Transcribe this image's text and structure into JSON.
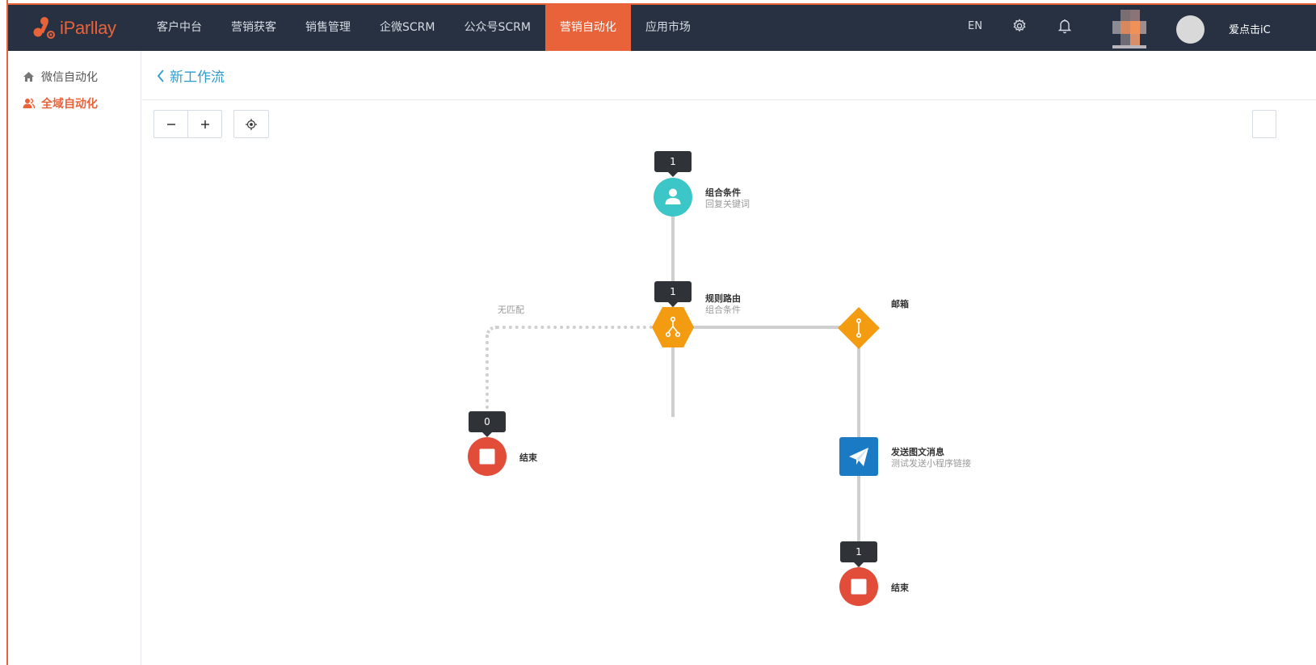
{
  "app": {
    "logo_text": "iParllay"
  },
  "nav": {
    "items": [
      "客户中台",
      "营销获客",
      "销售管理",
      "企微SCRM",
      "公众号SCRM",
      "营销自动化",
      "应用市场"
    ],
    "active_index": 5
  },
  "header_right": {
    "lang": "EN",
    "username": "爱点击iC"
  },
  "sidebar": {
    "items": [
      "微信自动化",
      "全域自动化"
    ],
    "active_index": 1
  },
  "page": {
    "back_label": "新工作流"
  },
  "colors": {
    "accent": "#e8633a",
    "nav_bg": "#273142",
    "link": "#2d9ccd",
    "trigger_node": "#3cc6c8",
    "router_node": "#f39c12",
    "end_node": "#e24d3a",
    "action_node": "#1a7bc4"
  },
  "flow": {
    "trigger": {
      "badge": "1",
      "title": "组合条件",
      "subtitle": "回复关键词",
      "icon": "user-icon"
    },
    "router": {
      "badge": "1",
      "title": "规则路由",
      "subtitle": "组合条件",
      "icon": "fork-icon"
    },
    "branch_no_match": {
      "label": "无匹配"
    },
    "branch_email": {
      "title": "邮箱",
      "icon": "branch-icon"
    },
    "end_left": {
      "badge": "0",
      "title": "结束",
      "icon": "stop-icon"
    },
    "send_message": {
      "title": "发送图文消息",
      "subtitle": "测试发送小程序链接",
      "icon": "paper-plane-icon"
    },
    "end_bottom": {
      "badge": "1",
      "title": "结束",
      "icon": "stop-icon"
    }
  }
}
